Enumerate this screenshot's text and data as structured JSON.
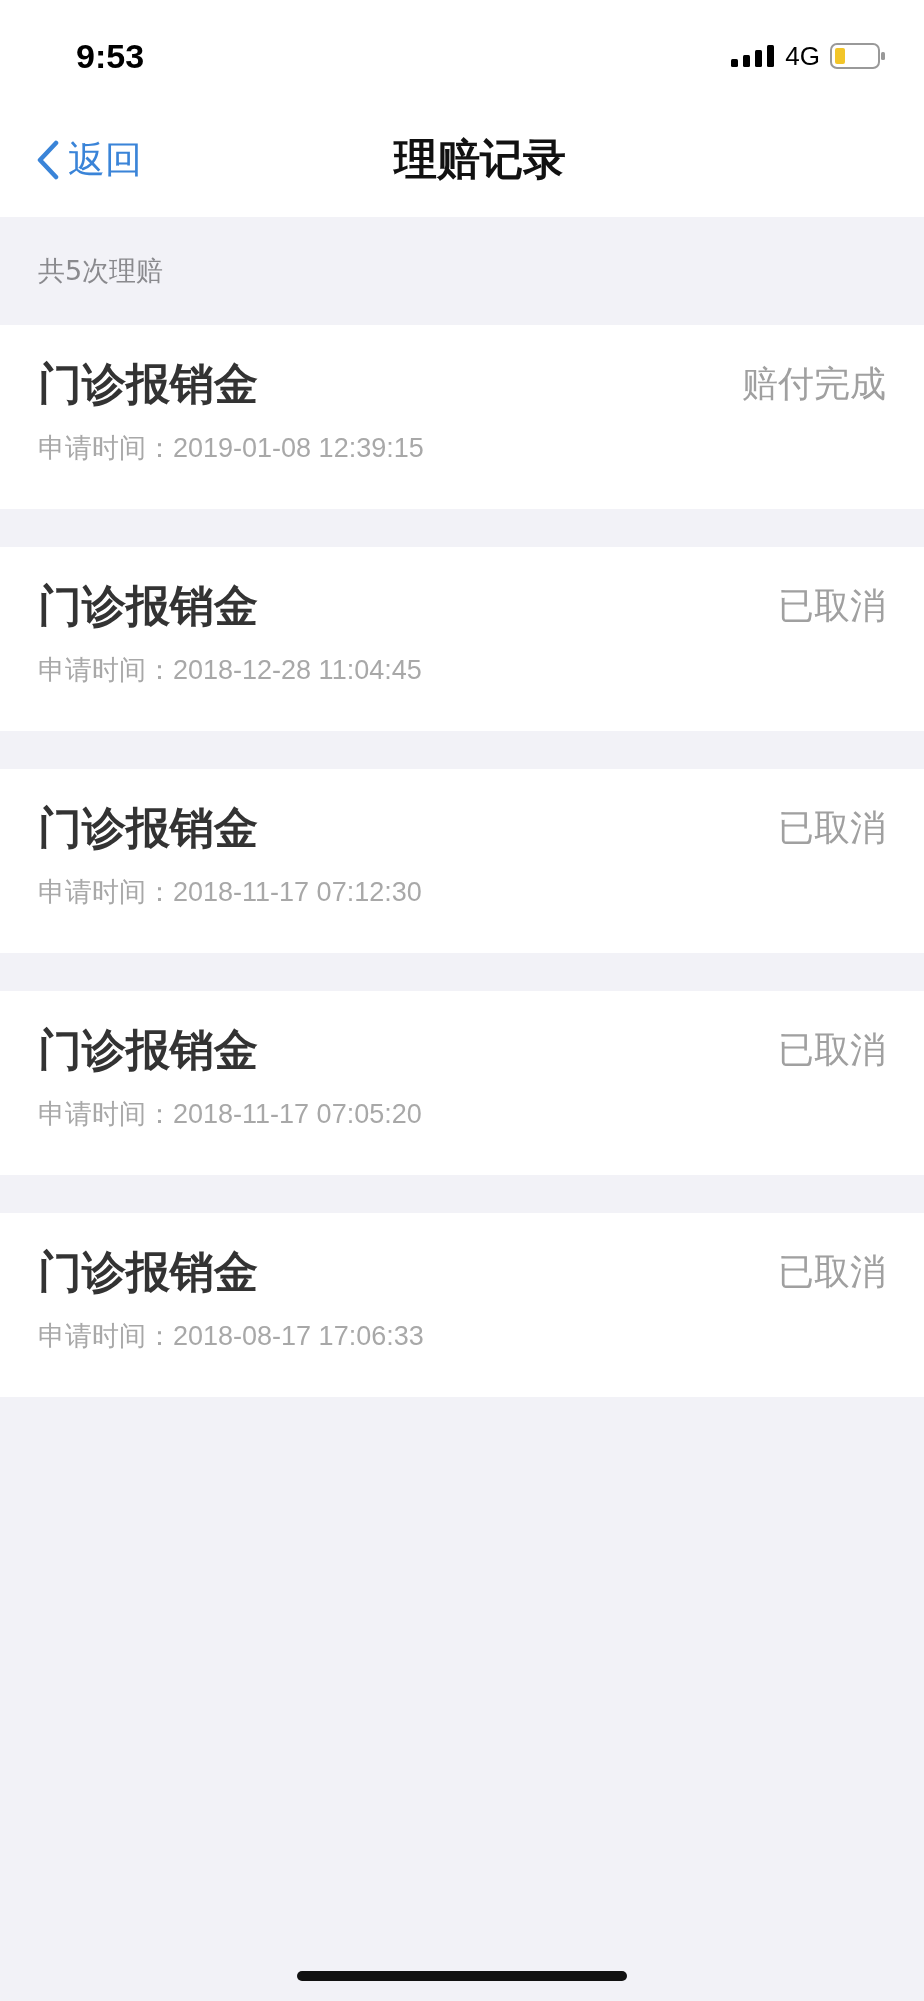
{
  "status_bar": {
    "time": "9:53",
    "network": "4G"
  },
  "nav": {
    "back": "返回",
    "title": "理赔记录"
  },
  "summary": "共5次理赔",
  "claims": [
    {
      "name": "门诊报销金",
      "status": "赔付完成",
      "time_label": "申请时间：",
      "time": "2019-01-08 12:39:15"
    },
    {
      "name": "门诊报销金",
      "status": "已取消",
      "time_label": "申请时间：",
      "time": "2018-12-28 11:04:45"
    },
    {
      "name": "门诊报销金",
      "status": "已取消",
      "time_label": "申请时间：",
      "time": "2018-11-17 07:12:30"
    },
    {
      "name": "门诊报销金",
      "status": "已取消",
      "time_label": "申请时间：",
      "time": "2018-11-17 07:05:20"
    },
    {
      "name": "门诊报销金",
      "status": "已取消",
      "time_label": "申请时间：",
      "time": "2018-08-17 17:06:33"
    }
  ]
}
